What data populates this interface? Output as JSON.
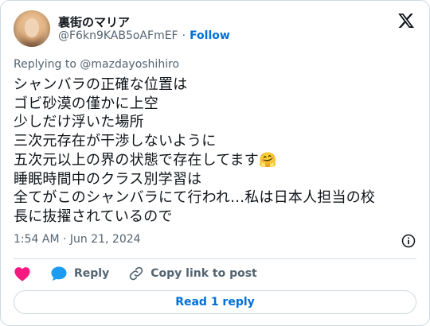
{
  "author": {
    "display_name": "裏街のマリア",
    "handle": "@F6kn9KAB5oAFmEF",
    "separator": "·",
    "follow_label": "Follow"
  },
  "replying_to": "Replying to @mazdayoshihiro",
  "tweet_text": "シャンバラの正確な位置は\nゴビ砂漠の僅かに上空\n少しだけ浮いた場所\n三次元存在が干渉しないように\n五次元以上の界の状態で存在してます🤗\n睡眠時間中のクラス別学習は\n全てがこのシャンバラにて行われ…私は日本人担当の校\n長に抜擢されているので",
  "timestamp": "1:54 AM · Jun 21, 2024",
  "actions": {
    "like_icon": "heart-icon",
    "reply_label": "Reply",
    "copy_label": "Copy link to post"
  },
  "read_replies_label": "Read 1 reply",
  "colors": {
    "accent": "#006fd6",
    "like": "#f91880",
    "reply_bubble": "#1d9bf0",
    "secondary_text": "#536471",
    "border": "#cfd9de"
  }
}
